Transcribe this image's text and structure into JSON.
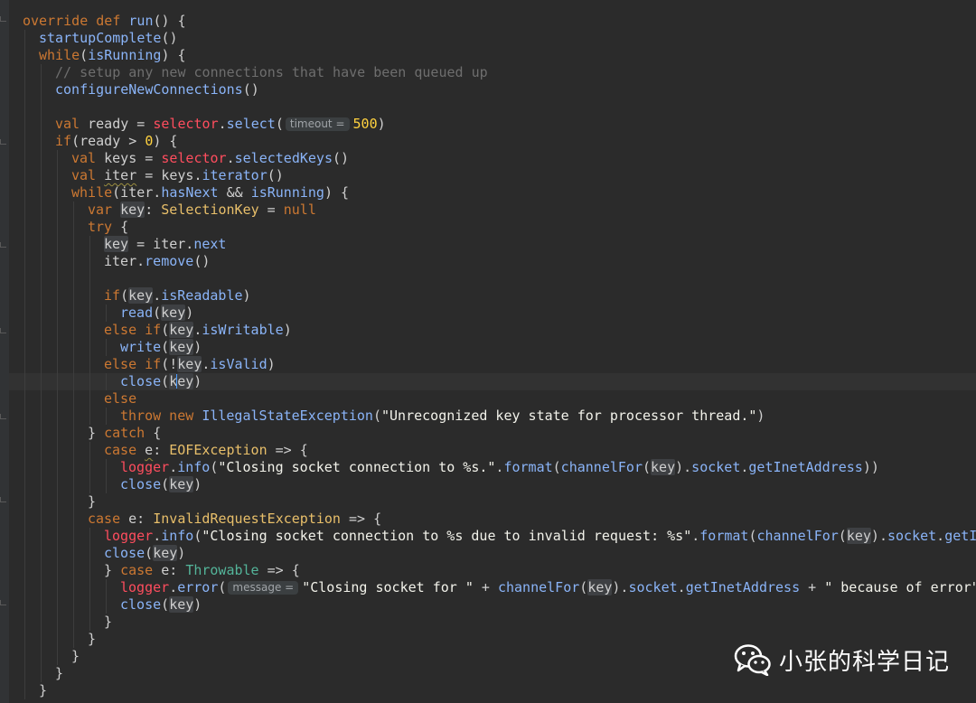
{
  "editor": {
    "colors": {
      "background": "#2b2b2b",
      "keyword": "#cc7832",
      "function": "#8ab4f8",
      "plain": "#cfcfcf",
      "string": "#f2f2ea",
      "number": "#ffd23f",
      "comment": "#6e6e6e",
      "type": "#e8bf6a",
      "field": "#ff4d5e",
      "throwable": "#54b59a"
    },
    "lines": [
      {
        "indent": 0,
        "guides": [],
        "tokens": [
          [
            "override def ",
            "kw"
          ],
          [
            "run",
            "fn"
          ],
          [
            "() {",
            "p"
          ]
        ]
      },
      {
        "indent": 1,
        "guides": [
          0
        ],
        "tokens": [
          [
            "startupComplete",
            "fn"
          ],
          [
            "()",
            "p"
          ]
        ]
      },
      {
        "indent": 1,
        "guides": [
          0
        ],
        "tokens": [
          [
            "while",
            "kw"
          ],
          [
            "(",
            "p"
          ],
          [
            "isRunning",
            "fn"
          ],
          [
            ") {",
            "p"
          ]
        ]
      },
      {
        "indent": 2,
        "guides": [
          0,
          1
        ],
        "tokens": [
          [
            "// setup any new connections that have been queued up",
            "cm"
          ]
        ]
      },
      {
        "indent": 2,
        "guides": [
          0,
          1
        ],
        "tokens": [
          [
            "configureNewConnections",
            "fn"
          ],
          [
            "()",
            "p"
          ]
        ]
      },
      {
        "indent": 0,
        "guides": [
          0,
          1
        ],
        "tokens": []
      },
      {
        "indent": 2,
        "guides": [
          0,
          1
        ],
        "tokens": [
          [
            "val ",
            "kw"
          ],
          [
            "ready = ",
            "p"
          ],
          [
            "selector",
            "fld"
          ],
          [
            ".",
            "p"
          ],
          [
            "select",
            "fn"
          ],
          [
            "(",
            "p"
          ],
          [
            "timeout =",
            "hint"
          ],
          [
            "500",
            "num"
          ],
          [
            ")",
            "p"
          ]
        ]
      },
      {
        "indent": 2,
        "guides": [
          0,
          1
        ],
        "tokens": [
          [
            "if",
            "kw"
          ],
          [
            "(ready > ",
            "p"
          ],
          [
            "0",
            "num"
          ],
          [
            ") {",
            "p"
          ]
        ]
      },
      {
        "indent": 3,
        "guides": [
          0,
          1,
          2
        ],
        "tokens": [
          [
            "val ",
            "kw"
          ],
          [
            "keys = ",
            "p"
          ],
          [
            "selector",
            "fld"
          ],
          [
            ".",
            "p"
          ],
          [
            "selectedKeys",
            "fn"
          ],
          [
            "()",
            "p"
          ]
        ]
      },
      {
        "indent": 3,
        "guides": [
          0,
          1,
          2
        ],
        "tokens": [
          [
            "val ",
            "kw"
          ],
          [
            "iter",
            "sq"
          ],
          [
            " = keys.",
            "p"
          ],
          [
            "iterator",
            "fn"
          ],
          [
            "()",
            "p"
          ]
        ]
      },
      {
        "indent": 3,
        "guides": [
          0,
          1,
          2
        ],
        "tokens": [
          [
            "while",
            "kw"
          ],
          [
            "(iter.",
            "p"
          ],
          [
            "hasNext",
            "fn"
          ],
          [
            " && ",
            "p"
          ],
          [
            "isRunning",
            "fn"
          ],
          [
            ") {",
            "p"
          ]
        ]
      },
      {
        "indent": 4,
        "guides": [
          0,
          1,
          2,
          3
        ],
        "tokens": [
          [
            "var ",
            "kw"
          ],
          [
            "key",
            "use"
          ],
          [
            ": ",
            "p"
          ],
          [
            "SelectionKey",
            "ty"
          ],
          [
            " = ",
            "p"
          ],
          [
            "null",
            "kw"
          ]
        ]
      },
      {
        "indent": 4,
        "guides": [
          0,
          1,
          2,
          3
        ],
        "tokens": [
          [
            "try",
            "kw"
          ],
          [
            " {",
            "p"
          ]
        ]
      },
      {
        "indent": 5,
        "guides": [
          0,
          1,
          2,
          3,
          4
        ],
        "tokens": [
          [
            "key",
            "use"
          ],
          [
            " = iter.",
            "p"
          ],
          [
            "next",
            "fn"
          ]
        ]
      },
      {
        "indent": 5,
        "guides": [
          0,
          1,
          2,
          3,
          4
        ],
        "tokens": [
          [
            "iter.",
            "p"
          ],
          [
            "remove",
            "fn"
          ],
          [
            "()",
            "p"
          ]
        ]
      },
      {
        "indent": 0,
        "guides": [
          0,
          1,
          2,
          3,
          4
        ],
        "tokens": []
      },
      {
        "indent": 5,
        "guides": [
          0,
          1,
          2,
          3,
          4
        ],
        "tokens": [
          [
            "if",
            "kw"
          ],
          [
            "(",
            "p"
          ],
          [
            "key",
            "use"
          ],
          [
            ".",
            "p"
          ],
          [
            "isReadable",
            "fn"
          ],
          [
            ")",
            "p"
          ]
        ]
      },
      {
        "indent": 6,
        "guides": [
          0,
          1,
          2,
          3,
          4,
          5
        ],
        "tokens": [
          [
            "read",
            "fn"
          ],
          [
            "(",
            "p"
          ],
          [
            "key",
            "use"
          ],
          [
            ")",
            "p"
          ]
        ]
      },
      {
        "indent": 5,
        "guides": [
          0,
          1,
          2,
          3,
          4
        ],
        "tokens": [
          [
            "else if",
            "kw"
          ],
          [
            "(",
            "p"
          ],
          [
            "key",
            "use"
          ],
          [
            ".",
            "p"
          ],
          [
            "isWritable",
            "fn"
          ],
          [
            ")",
            "p"
          ]
        ]
      },
      {
        "indent": 6,
        "guides": [
          0,
          1,
          2,
          3,
          4,
          5
        ],
        "tokens": [
          [
            "write",
            "fn"
          ],
          [
            "(",
            "p"
          ],
          [
            "key",
            "use"
          ],
          [
            ")",
            "p"
          ]
        ]
      },
      {
        "indent": 5,
        "guides": [
          0,
          1,
          2,
          3,
          4
        ],
        "tokens": [
          [
            "else if",
            "kw"
          ],
          [
            "(!",
            "p"
          ],
          [
            "key",
            "use"
          ],
          [
            ".",
            "p"
          ],
          [
            "isValid",
            "fn"
          ],
          [
            ")",
            "p"
          ]
        ]
      },
      {
        "indent": 6,
        "guides": [
          0,
          1,
          2,
          3,
          4,
          5
        ],
        "tokens": [
          [
            "close",
            "fn"
          ],
          [
            "(",
            "p"
          ],
          [
            "k",
            "use"
          ],
          [
            "caret",
            "caret"
          ],
          [
            "ey",
            "use"
          ],
          [
            ")",
            "p"
          ]
        ]
      },
      {
        "indent": 5,
        "guides": [
          0,
          1,
          2,
          3,
          4
        ],
        "tokens": [
          [
            "else",
            "kw"
          ]
        ]
      },
      {
        "indent": 6,
        "guides": [
          0,
          1,
          2,
          3,
          4,
          5
        ],
        "tokens": [
          [
            "throw new ",
            "kw"
          ],
          [
            "IllegalStateException",
            "fn"
          ],
          [
            "(",
            "p"
          ],
          [
            "\"Unrecognized key state for processor thread.\"",
            "str"
          ],
          [
            ")",
            "p"
          ]
        ]
      },
      {
        "indent": 4,
        "guides": [
          0,
          1,
          2,
          3
        ],
        "tokens": [
          [
            "} ",
            "p"
          ],
          [
            "catch",
            "kw"
          ],
          [
            " {",
            "p"
          ]
        ]
      },
      {
        "indent": 5,
        "guides": [
          0,
          1,
          2,
          3,
          4
        ],
        "tokens": [
          [
            "case ",
            "kw"
          ],
          [
            "e",
            "sq"
          ],
          [
            ": ",
            "p"
          ],
          [
            "EOFException",
            "ty"
          ],
          [
            " => {",
            "p"
          ]
        ]
      },
      {
        "indent": 6,
        "guides": [
          0,
          1,
          2,
          3,
          4,
          5
        ],
        "tokens": [
          [
            "logger",
            "fld"
          ],
          [
            ".",
            "p"
          ],
          [
            "info",
            "fn"
          ],
          [
            "(",
            "p"
          ],
          [
            "\"Closing socket connection to %s.\"",
            "str"
          ],
          [
            ".",
            "p"
          ],
          [
            "format",
            "fn"
          ],
          [
            "(",
            "p"
          ],
          [
            "channelFor",
            "fn"
          ],
          [
            "(",
            "p"
          ],
          [
            "key",
            "use"
          ],
          [
            ").",
            "p"
          ],
          [
            "socket",
            "fn"
          ],
          [
            ".",
            "p"
          ],
          [
            "getInetAddress",
            "fn"
          ],
          [
            "))",
            "p"
          ]
        ]
      },
      {
        "indent": 6,
        "guides": [
          0,
          1,
          2,
          3,
          4,
          5
        ],
        "tokens": [
          [
            "close",
            "fn"
          ],
          [
            "(",
            "p"
          ],
          [
            "key",
            "use"
          ],
          [
            ")",
            "p"
          ]
        ]
      },
      {
        "indent": 4,
        "guides": [
          0,
          1,
          2,
          3
        ],
        "tokens": [
          [
            "}",
            "p"
          ]
        ]
      },
      {
        "indent": 4,
        "guides": [
          0,
          1,
          2,
          3
        ],
        "tokens": [
          [
            "case ",
            "kw"
          ],
          [
            "e: ",
            "p"
          ],
          [
            "InvalidRequestException",
            "ty"
          ],
          [
            " => {",
            "p"
          ]
        ]
      },
      {
        "indent": 5,
        "guides": [
          0,
          1,
          2,
          3,
          4
        ],
        "tokens": [
          [
            "logger",
            "fld"
          ],
          [
            ".",
            "p"
          ],
          [
            "info",
            "fn"
          ],
          [
            "(",
            "p"
          ],
          [
            "\"Closing socket connection to %s due to invalid request: %s\"",
            "str"
          ],
          [
            ".",
            "p"
          ],
          [
            "format",
            "fn"
          ],
          [
            "(",
            "p"
          ],
          [
            "channelFor",
            "fn"
          ],
          [
            "(",
            "p"
          ],
          [
            "key",
            "use"
          ],
          [
            ").",
            "p"
          ],
          [
            "socket",
            "fn"
          ],
          [
            ".",
            "p"
          ],
          [
            "getInetAd",
            "fn"
          ]
        ]
      },
      {
        "indent": 5,
        "guides": [
          0,
          1,
          2,
          3,
          4
        ],
        "tokens": [
          [
            "close",
            "fn"
          ],
          [
            "(",
            "p"
          ],
          [
            "key",
            "use"
          ],
          [
            ")",
            "p"
          ]
        ]
      },
      {
        "indent": 5,
        "guides": [
          0,
          1,
          2,
          3,
          4
        ],
        "tokens": [
          [
            "} ",
            "p"
          ],
          [
            "case ",
            "kw"
          ],
          [
            "e: ",
            "p"
          ],
          [
            "Throwable",
            "thr"
          ],
          [
            " => {",
            "p"
          ]
        ]
      },
      {
        "indent": 6,
        "guides": [
          0,
          1,
          2,
          3,
          4,
          5
        ],
        "tokens": [
          [
            "logger",
            "fld"
          ],
          [
            ".",
            "p"
          ],
          [
            "error",
            "fn"
          ],
          [
            "(",
            "p"
          ],
          [
            "message =",
            "hint"
          ],
          [
            "\"Closing socket for \"",
            "str"
          ],
          [
            " + ",
            "p"
          ],
          [
            "channelFor",
            "fn"
          ],
          [
            "(",
            "p"
          ],
          [
            "key",
            "use"
          ],
          [
            ").",
            "p"
          ],
          [
            "socket",
            "fn"
          ],
          [
            ".",
            "p"
          ],
          [
            "getInetAddress",
            "fn"
          ],
          [
            " + ",
            "p"
          ],
          [
            "\" because of error\"",
            "str"
          ],
          [
            ",",
            "p"
          ]
        ]
      },
      {
        "indent": 6,
        "guides": [
          0,
          1,
          2,
          3,
          4,
          5
        ],
        "tokens": [
          [
            "close",
            "fn"
          ],
          [
            "(",
            "p"
          ],
          [
            "key",
            "use"
          ],
          [
            ")",
            "p"
          ]
        ]
      },
      {
        "indent": 5,
        "guides": [
          0,
          1,
          2,
          3,
          4
        ],
        "tokens": [
          [
            "}",
            "p"
          ]
        ]
      },
      {
        "indent": 4,
        "guides": [
          0,
          1,
          2,
          3
        ],
        "tokens": [
          [
            "}",
            "p"
          ]
        ]
      },
      {
        "indent": 3,
        "guides": [
          0,
          1,
          2
        ],
        "tokens": [
          [
            "}",
            "p"
          ]
        ]
      },
      {
        "indent": 2,
        "guides": [
          0,
          1
        ],
        "tokens": [
          [
            "}",
            "p"
          ]
        ]
      },
      {
        "indent": 1,
        "guides": [
          0
        ],
        "tokens": [
          [
            "}",
            "p"
          ]
        ]
      }
    ]
  },
  "watermark": {
    "text": "小张的科学日记",
    "icon": "wechat-icon"
  }
}
